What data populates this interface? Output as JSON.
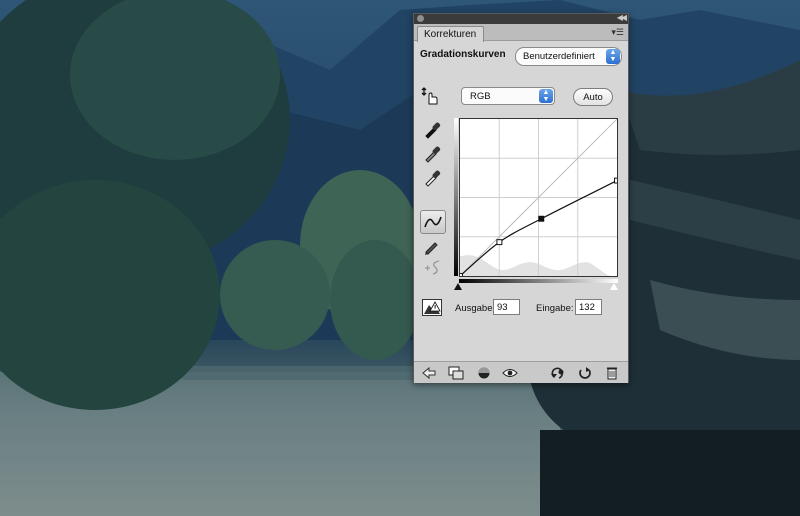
{
  "panel": {
    "tab_label": "Korrekturen",
    "adjustment_title": "Gradationskurven",
    "preset_value": "Benutzerdefiniert",
    "channel_value": "RGB",
    "auto_label": "Auto",
    "output_label": "Ausgabe:",
    "output_value": "93",
    "input_label": "Eingabe:",
    "input_value": "132"
  },
  "curve": {
    "range": [
      0,
      255
    ],
    "points": [
      [
        0,
        0
      ],
      [
        64,
        55
      ],
      [
        132,
        93
      ],
      [
        255,
        155
      ]
    ]
  },
  "icons": {
    "tools": [
      "on-image-adjust-icon",
      "black-point-eyedropper-icon",
      "gray-point-eyedropper-icon",
      "white-point-eyedropper-icon",
      "curve-points-icon",
      "pencil-draw-icon",
      "smooth-curve-icon",
      "clipping-warning-icon"
    ],
    "footer": [
      "back-arrow-icon",
      "clip-to-layer-icon",
      "visibility-toggle-icon",
      "eye-icon",
      "previous-state-icon",
      "reset-icon",
      "trash-icon"
    ]
  },
  "colors": {
    "panel_bg": "#d6d6d6",
    "select_accent": "#2d6fd0"
  }
}
